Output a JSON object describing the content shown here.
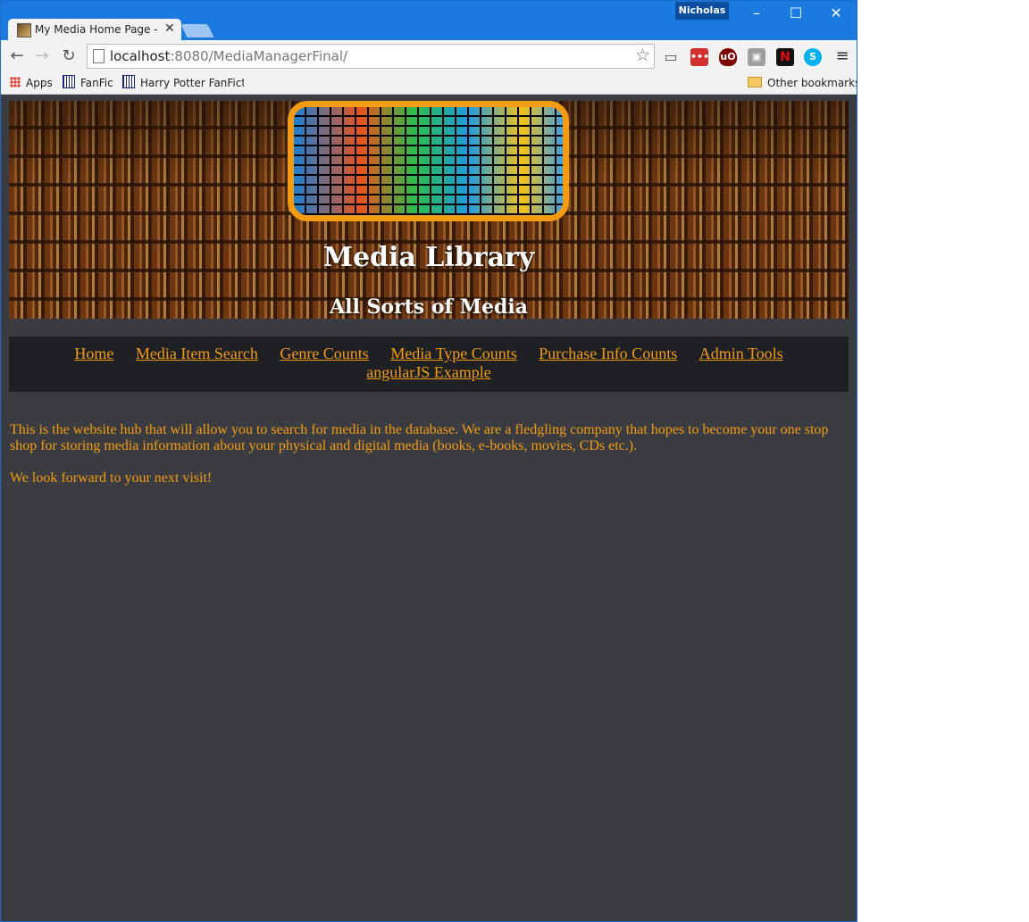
{
  "browser": {
    "tab_title": "My Media Home Page - D",
    "tab_close": "✕",
    "profile_name": "Nicholas",
    "window_controls": {
      "minimize": "–",
      "maximize": "☐",
      "close": "✕"
    },
    "url_host": "localhost",
    "url_rest": ":8080/MediaManagerFinal/",
    "extensions": [
      {
        "name": "lastpass-icon",
        "text": "•••",
        "color": "#d32f2f"
      },
      {
        "name": "ublock-icon",
        "text": "uO",
        "color": "#800000"
      },
      {
        "name": "extension-icon",
        "text": "▣",
        "color": "#9e9e9e"
      },
      {
        "name": "netflix-icon",
        "text": "N",
        "color": "#111111"
      },
      {
        "name": "skype-icon",
        "text": "S",
        "color": "#00aff0"
      }
    ],
    "bookmarks": {
      "apps": "Apps",
      "item1": "FanFic",
      "item2": "Harry Potter FanFictio",
      "other": "Other bookmarks"
    }
  },
  "page": {
    "title": "Media Library",
    "subtitle": "All Sorts of Media",
    "nav": {
      "home": "Home",
      "search": "Media Item Search",
      "genre": "Genre Counts",
      "type": "Media Type Counts",
      "purchase": "Purchase Info Counts",
      "admin": "Admin Tools",
      "angular": "angularJS Example"
    },
    "intro": "This is the website hub that will allow you to search for media in the database. We are a fledgling company that hopes to become your one stop shop for storing media information about your physical and digital media (books, e-books, movies, CDs etc.).",
    "closing": "We look forward to your next visit!",
    "accent_color": "#f39c12",
    "background_color": "#3b3c41"
  }
}
